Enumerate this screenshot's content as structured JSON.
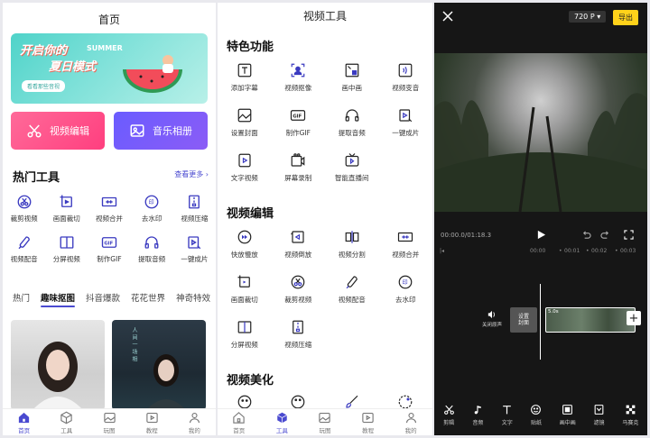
{
  "home": {
    "title": "首页",
    "banner": {
      "line1": "开启你的",
      "en": "SUMMER",
      "line2": "夏日模式",
      "pill": "看看那些音视"
    },
    "btn_video": "视频编辑",
    "btn_music": "音乐相册",
    "hot_title": "热门工具",
    "more": "查看更多 ›",
    "tools": [
      {
        "label": "裁剪视频",
        "icon": "scissors-icon"
      },
      {
        "label": "画面裁切",
        "icon": "crop-icon"
      },
      {
        "label": "视频合并",
        "icon": "merge-icon"
      },
      {
        "label": "去水印",
        "icon": "watermark-icon"
      },
      {
        "label": "视频压缩",
        "icon": "compress-icon"
      },
      {
        "label": "视频配音",
        "icon": "dub-icon"
      },
      {
        "label": "分屏视频",
        "icon": "split-screen-icon"
      },
      {
        "label": "制作GIF",
        "icon": "gif-icon"
      },
      {
        "label": "提取音频",
        "icon": "headphone-icon"
      },
      {
        "label": "一键成片",
        "icon": "one-click-icon"
      }
    ],
    "tabs": [
      "热门",
      "趣味抠图",
      "抖音爆款",
      "花花世界",
      "神奇特效"
    ],
    "active_tab": 1,
    "photo2_text": "人间一场相"
  },
  "nav": {
    "items": [
      {
        "label": "首页",
        "icon": "home-icon"
      },
      {
        "label": "工具",
        "icon": "tool-icon"
      },
      {
        "label": "玩图",
        "icon": "image-icon"
      },
      {
        "label": "教程",
        "icon": "play-square-icon"
      },
      {
        "label": "我的",
        "icon": "user-icon"
      }
    ]
  },
  "tools_page": {
    "title": "视频工具",
    "sections": [
      {
        "title": "特色功能",
        "items": [
          "添加字幕",
          "视频抠像",
          "画中画",
          "视频变音",
          "设置封面",
          "制作GIF",
          "提取音频",
          "一键成片",
          "文字视频",
          "屏幕录制",
          "智能直播间"
        ]
      },
      {
        "title": "视频编辑",
        "items": [
          "快放慢放",
          "视频倒放",
          "视频分割",
          "视频合并",
          "画面裁切",
          "裁剪视频",
          "视频配音",
          "去水印",
          "分屏视频",
          "视频压缩"
        ]
      },
      {
        "title": "视频美化",
        "items": [
          "",
          "",
          "",
          ""
        ]
      }
    ],
    "active_nav": 1
  },
  "editor": {
    "resolution": "720 P",
    "export": "导出",
    "timecode": "00:00.0/01:18.3",
    "ticks": [
      "00:00",
      "00:01",
      "00:02",
      "00:03"
    ],
    "mute_label": "关闭原声",
    "cover_label": "设置\n封面",
    "clip_duration": "5.0s",
    "tools": [
      {
        "label": "剪辑",
        "icon": "scissors-icon"
      },
      {
        "label": "音频",
        "icon": "music-note-icon"
      },
      {
        "label": "文字",
        "icon": "text-icon"
      },
      {
        "label": "贴纸",
        "icon": "sticker-icon"
      },
      {
        "label": "画中画",
        "icon": "pip-icon"
      },
      {
        "label": "滤镜",
        "icon": "filter-icon"
      },
      {
        "label": "马赛克",
        "icon": "mosaic-icon"
      }
    ]
  },
  "colors": {
    "accent": "#4a4ad0",
    "pink": "#ff4f86",
    "purple": "#7a5cff",
    "export": "#ffd21a"
  }
}
